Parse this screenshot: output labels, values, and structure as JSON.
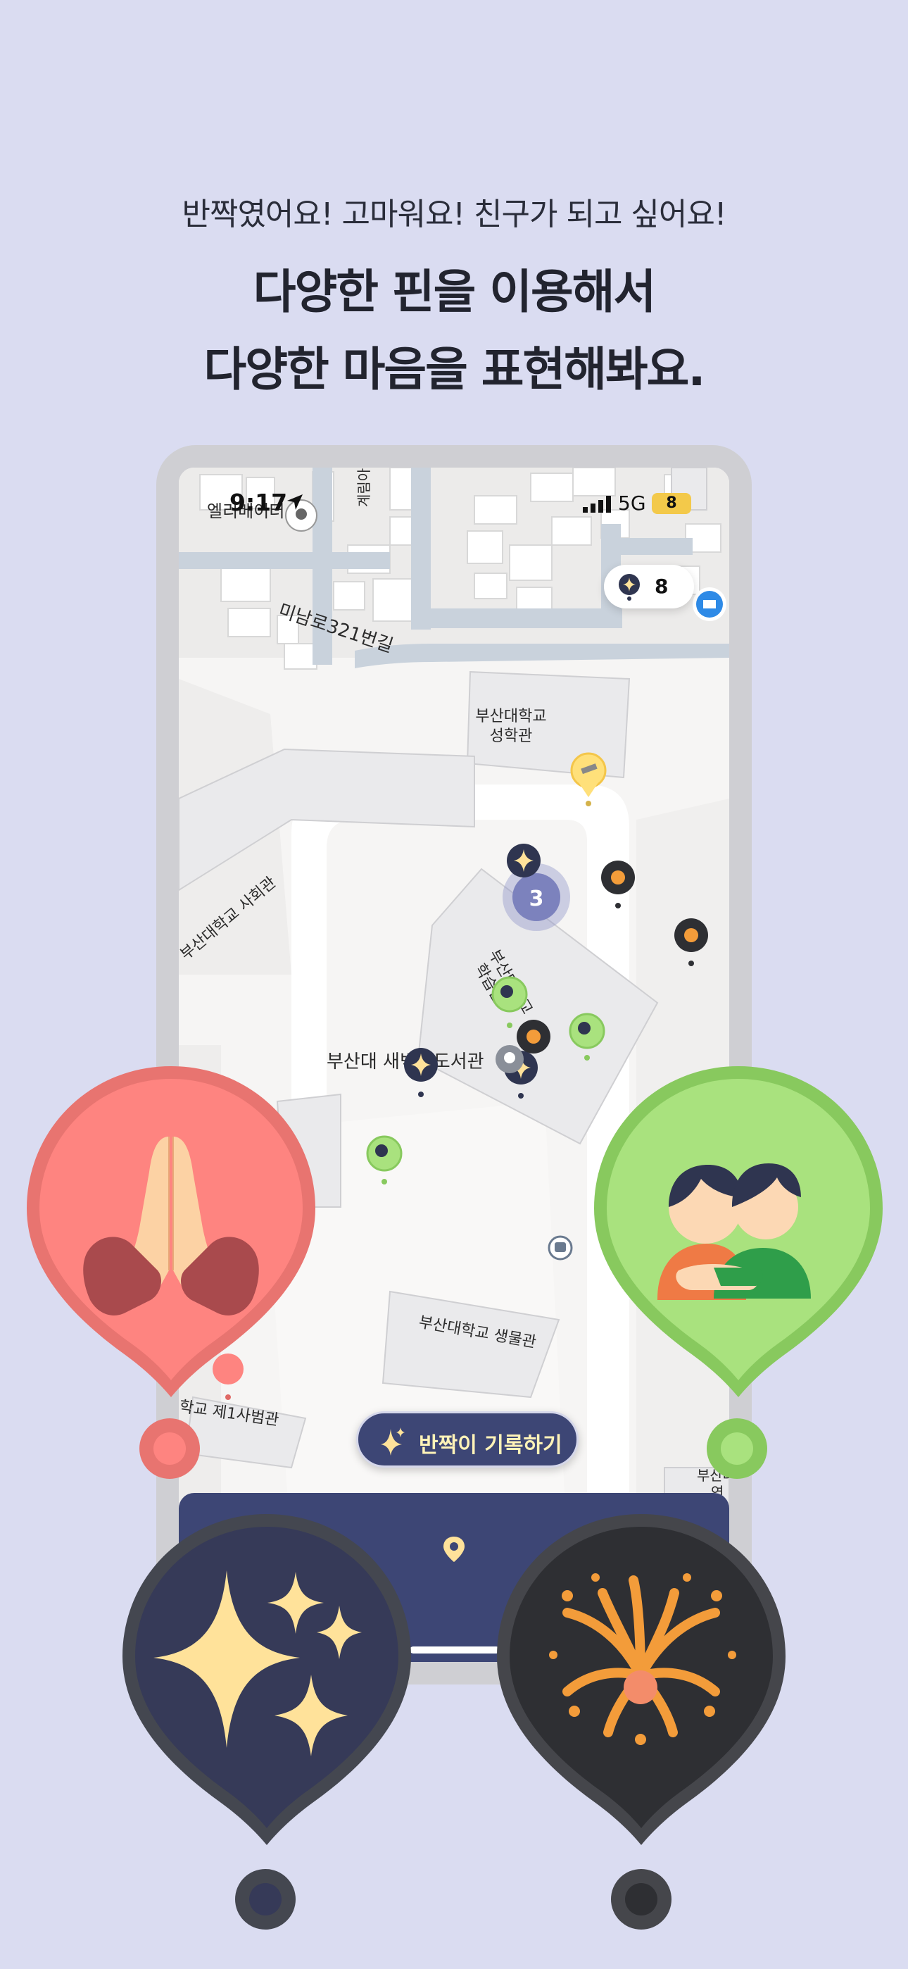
{
  "header": {
    "subtitle": "반짝였어요! 고마워요! 친구가 되고 싶어요!",
    "title_line1": "다양한 핀을 이용해서",
    "title_line2": "다양한 마음을 표현해봐요."
  },
  "status_bar": {
    "time": "9:17",
    "network": "5G",
    "battery": "8"
  },
  "map": {
    "pin_counter": "8",
    "cluster_count": "3",
    "labels": {
      "elevator": "엘리베이터",
      "gyerim": "계림아",
      "street": "미남로321번길",
      "seonghakgwan_1": "부산대학교",
      "seonghakgwan_2": "성학관",
      "social_hall": "부산대학교 사회관",
      "study_hall_1": "부산대학교",
      "study_hall_2": "학습관",
      "library": "부산대 새벽벌도서관",
      "biology_1": "부산대학교 생물관",
      "first_hall": "학교 제1사범관",
      "right_edge_1": "부산대",
      "right_edge_2": "연"
    }
  },
  "actions": {
    "record_label": "반짝이 기록하기"
  },
  "pins": {
    "red": "praying-hands",
    "green": "hugging-friends",
    "navy": "sparkles",
    "dark": "fireworks"
  },
  "colors": {
    "background": "#dadcf1",
    "navy": "#3d4675",
    "red_pin": "#fe8480",
    "green_pin": "#a9e27e",
    "dark_pin": "#2e2f33",
    "sparkle": "#ffe29a"
  }
}
